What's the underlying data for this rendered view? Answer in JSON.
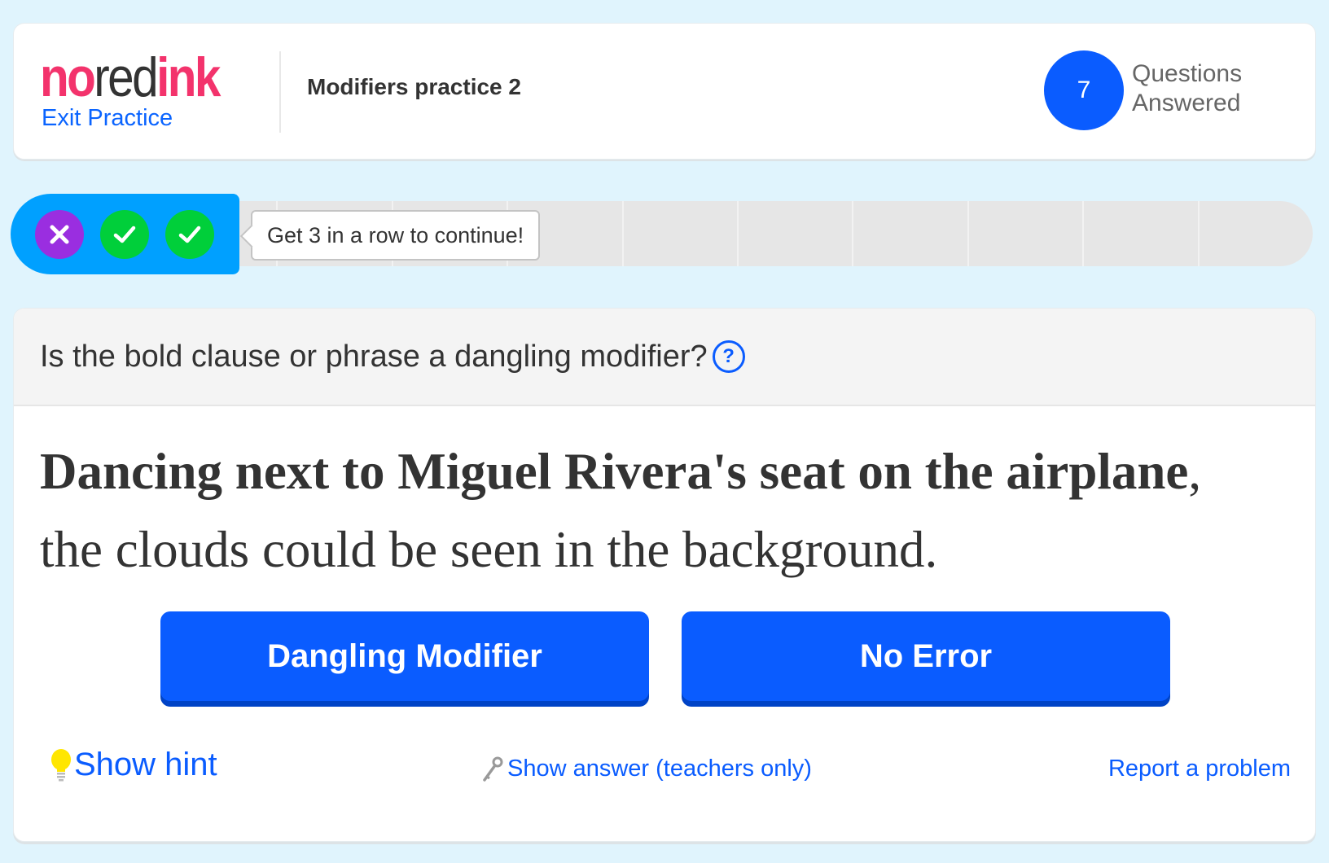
{
  "header": {
    "logo": {
      "no": "no",
      "red": "red",
      "ink": "ink"
    },
    "exit_label": "Exit Practice",
    "practice_title": "Modifiers practice 2",
    "questions_answered_count": "7",
    "questions_answered_label_1": "Questions",
    "questions_answered_label_2": "Answered"
  },
  "progress": {
    "streak": [
      {
        "result": "wrong",
        "icon": "x-icon"
      },
      {
        "result": "correct",
        "icon": "check-icon"
      },
      {
        "result": "correct",
        "icon": "check-icon"
      }
    ],
    "tooltip": "Get 3 in a row to continue!",
    "segments_total": 9
  },
  "question": {
    "prompt": "Is the bold clause or phrase a dangling modifier?",
    "help_icon": "?",
    "sentence_bold": "Dancing next to Miguel Rivera's seat on the airplane",
    "sentence_rest": ", the clouds could be seen in the background.",
    "choices": [
      {
        "label": "Dangling Modifier"
      },
      {
        "label": "No Error"
      }
    ]
  },
  "footer": {
    "show_hint": "Show hint",
    "show_answer": "Show answer (teachers only)",
    "report_problem": "Report a problem"
  },
  "colors": {
    "background": "#e0f4fd",
    "brand_pink": "#f3336c",
    "primary_blue": "#0a5cff",
    "streak_blue": "#00a0ff",
    "wrong_purple": "#9a2ee0",
    "correct_green": "#00cf3a"
  }
}
